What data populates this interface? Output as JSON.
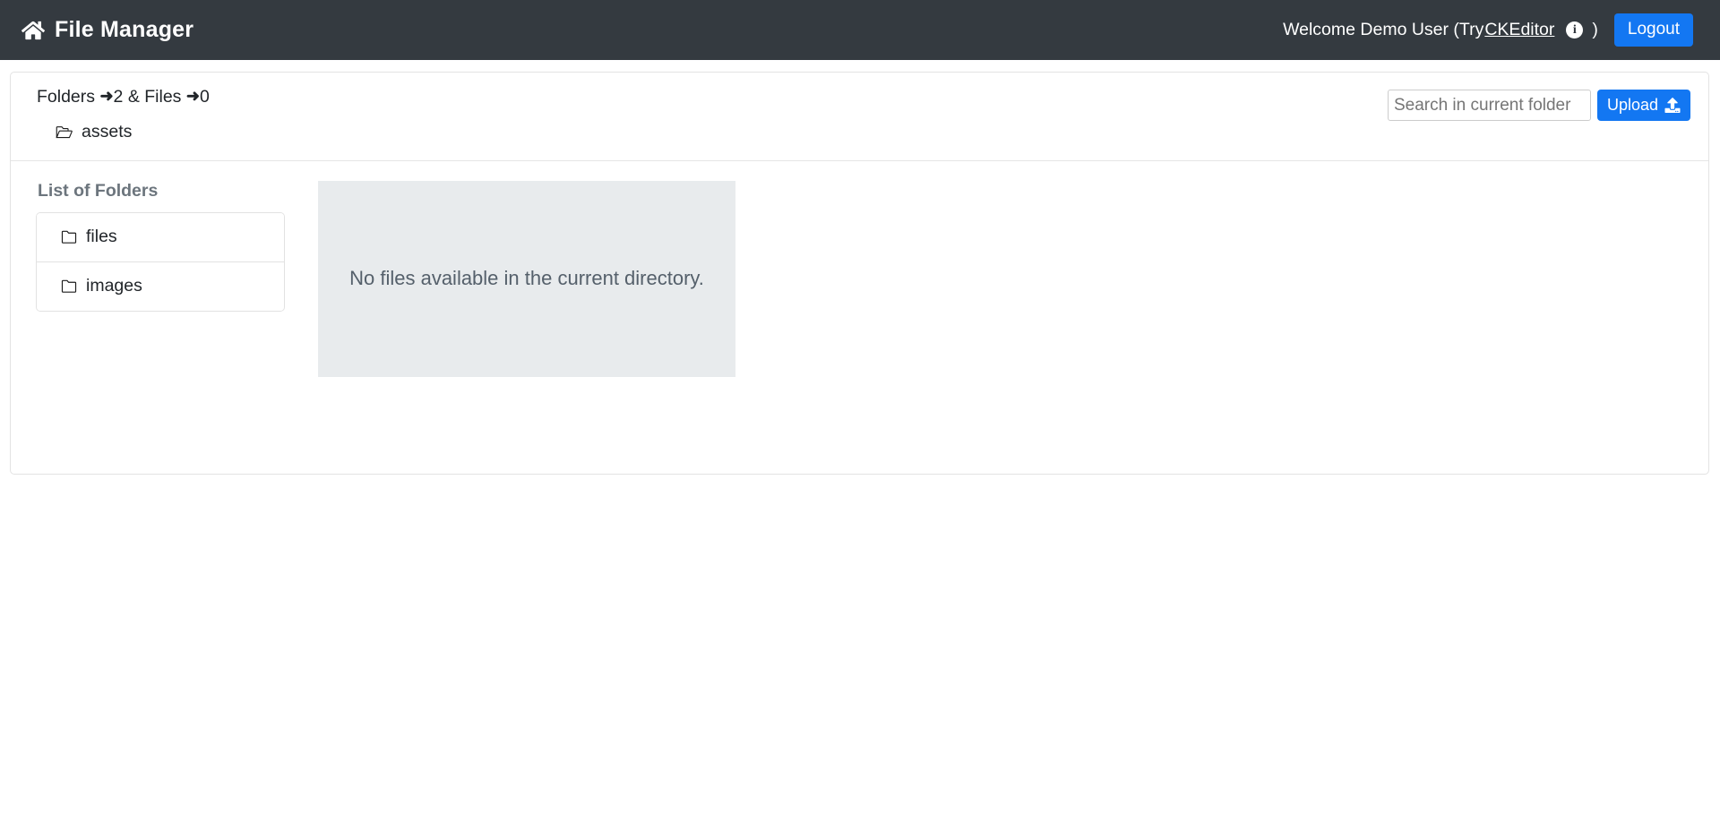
{
  "navbar": {
    "brand": "File Manager",
    "brand_icon": "home-icon",
    "welcome_prefix": "Welcome Demo User (Try ",
    "ckeditor_link": "CKEditor",
    "info_icon_glyph": "i",
    "close_paren": ")",
    "logout_label": "Logout",
    "background_color": "#343a40",
    "accent_color": "#1377f2"
  },
  "toolbar": {
    "counts_prefix": "Folders ",
    "arrow": "➜",
    "folders_count": "2",
    "counts_mid": " & Files ",
    "files_count": "0",
    "current_path": "assets",
    "path_icon": "open-folder-icon",
    "search_placeholder": "Search in current folder",
    "search_value": "",
    "upload_label": "Upload",
    "upload_icon": "upload-icon"
  },
  "folders": {
    "title": "List of Folders",
    "items": [
      {
        "name": "files",
        "icon": "folder-icon"
      },
      {
        "name": "images",
        "icon": "folder-icon"
      }
    ]
  },
  "files": {
    "empty_message": "No files available in the current directory.",
    "panel_color": "#e8ebed"
  }
}
